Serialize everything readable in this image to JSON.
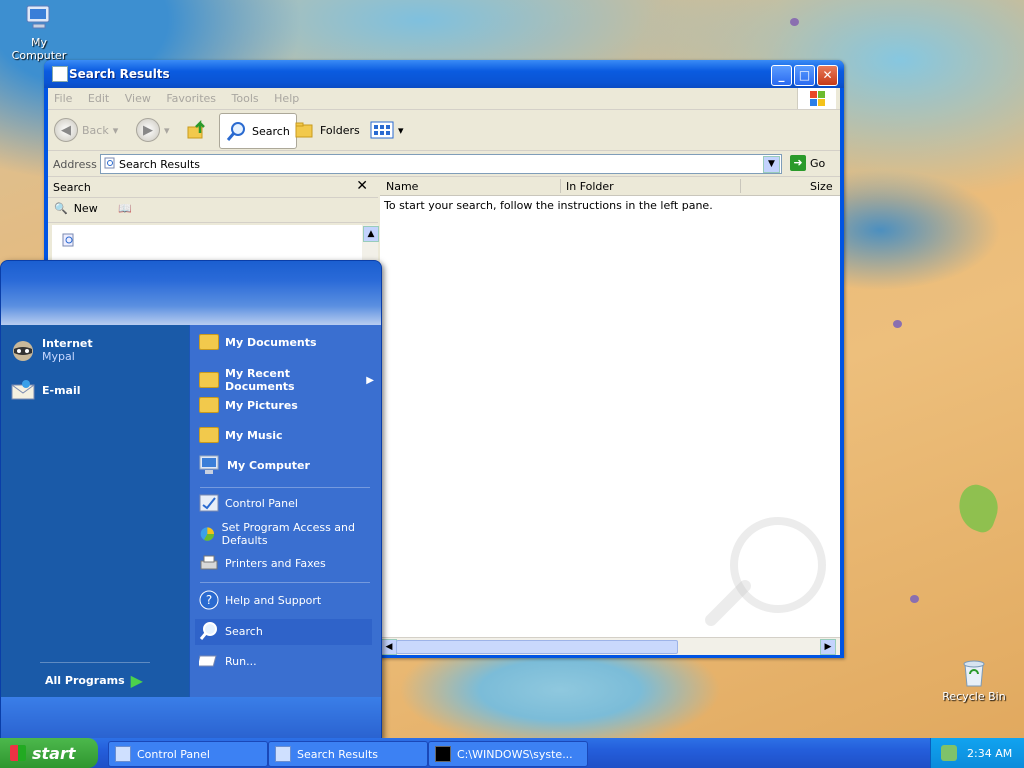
{
  "desktop": {
    "icons": [
      {
        "label": "My Computer"
      },
      {
        "label": "Recycle Bin"
      }
    ]
  },
  "window": {
    "title": "Search Results",
    "menu": [
      "File",
      "Edit",
      "View",
      "Favorites",
      "Tools",
      "Help"
    ],
    "toolbar": {
      "back": "Back",
      "search": "Search",
      "folders": "Folders"
    },
    "address": {
      "label": "Address",
      "value": "Search Results",
      "go": "Go"
    },
    "search_pane": {
      "title": "Search",
      "new_label": "New"
    },
    "results": {
      "columns": [
        "Name",
        "In Folder",
        "Size"
      ],
      "instructions": "To start your search, follow the instructions in the left pane."
    }
  },
  "start_menu": {
    "pinned": [
      {
        "label": "Internet",
        "sub": "Mypal",
        "icon": "raccoon-icon"
      },
      {
        "label": "E-mail",
        "sub": "",
        "icon": "email-icon"
      }
    ],
    "all_programs": "All Programs",
    "right": [
      {
        "label": "My Documents",
        "icon": "documents-folder-icon"
      },
      {
        "label": "My Recent Documents",
        "icon": "recent-folder-icon"
      },
      {
        "label": "My Pictures",
        "icon": "pictures-folder-icon"
      },
      {
        "label": "My Music",
        "icon": "music-folder-icon"
      },
      {
        "label": "My Computer",
        "icon": "computer-icon"
      },
      {
        "label": "Control Panel",
        "icon": "control-panel-icon"
      },
      {
        "label": "Set Program Access and Defaults",
        "icon": "program-access-icon"
      },
      {
        "label": "Printers and Faxes",
        "icon": "printer-icon"
      },
      {
        "label": "Help and Support",
        "icon": "help-icon"
      },
      {
        "label": "Search",
        "icon": "search-icon"
      },
      {
        "label": "Run...",
        "icon": "run-icon"
      }
    ]
  },
  "taskbar": {
    "start_label": "start",
    "tasks": [
      {
        "label": "Control Panel"
      },
      {
        "label": "Search Results"
      },
      {
        "label": "C:\\WINDOWS\\syste..."
      }
    ],
    "clock": "2:34 AM"
  },
  "colors": {
    "xp_blue": "#0054e3",
    "start_green": "#3aa83a",
    "taskbar_blue": "#245edb"
  }
}
